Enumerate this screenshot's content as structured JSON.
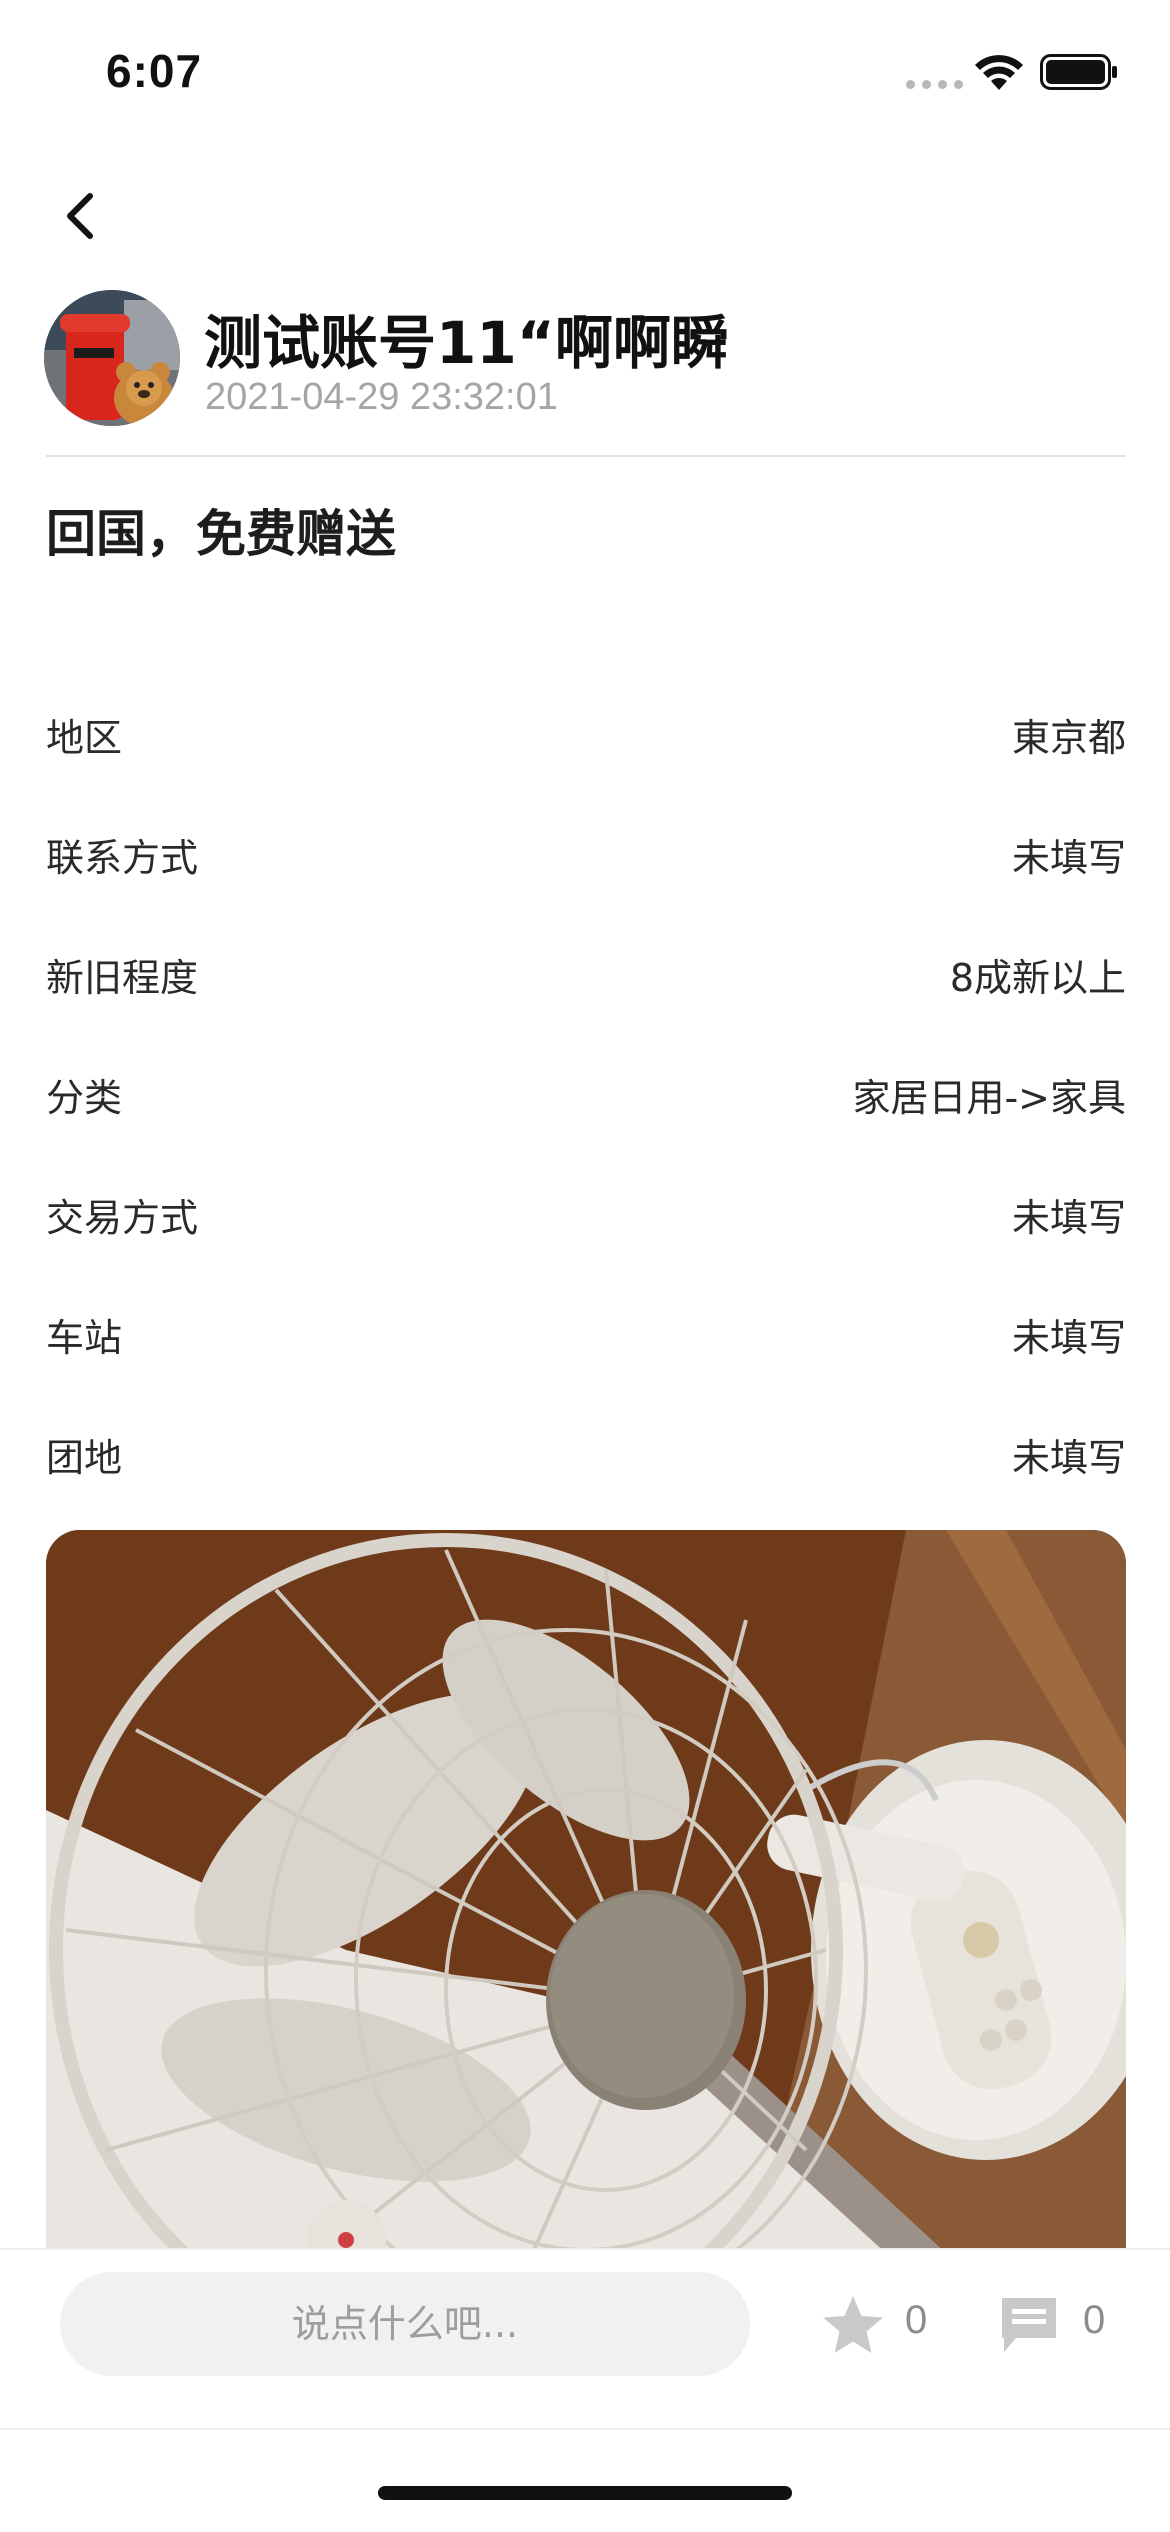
{
  "status_bar": {
    "time": "6:07",
    "icons": [
      "signal-icon",
      "wifi-icon",
      "battery-icon"
    ]
  },
  "nav": {
    "back_icon": "chevron-left-icon"
  },
  "author": {
    "name": "测试账号11“啊啊瞬",
    "timestamp": "2021-04-29 23:32:01"
  },
  "post": {
    "title": "回国，免费赠送",
    "details": [
      {
        "label": "地区",
        "value": "東京都"
      },
      {
        "label": "联系方式",
        "value": "未填写"
      },
      {
        "label": "新旧程度",
        "value": "8成新以上"
      },
      {
        "label": "分类",
        "value": "家居日用->家具"
      },
      {
        "label": "交易方式",
        "value": "未填写"
      },
      {
        "label": "车站",
        "value": "未填写"
      },
      {
        "label": "团地",
        "value": "未填写"
      }
    ]
  },
  "bottom_bar": {
    "comment_placeholder": "说点什么吧...",
    "like_count": "0",
    "comment_count": "0"
  },
  "colors": {
    "text_primary": "#1d1d1d",
    "text_secondary": "#a5a5a5",
    "divider": "#e4e4e4",
    "input_bg": "#f1f1f1",
    "icon_gray": "#c9c9c9"
  }
}
